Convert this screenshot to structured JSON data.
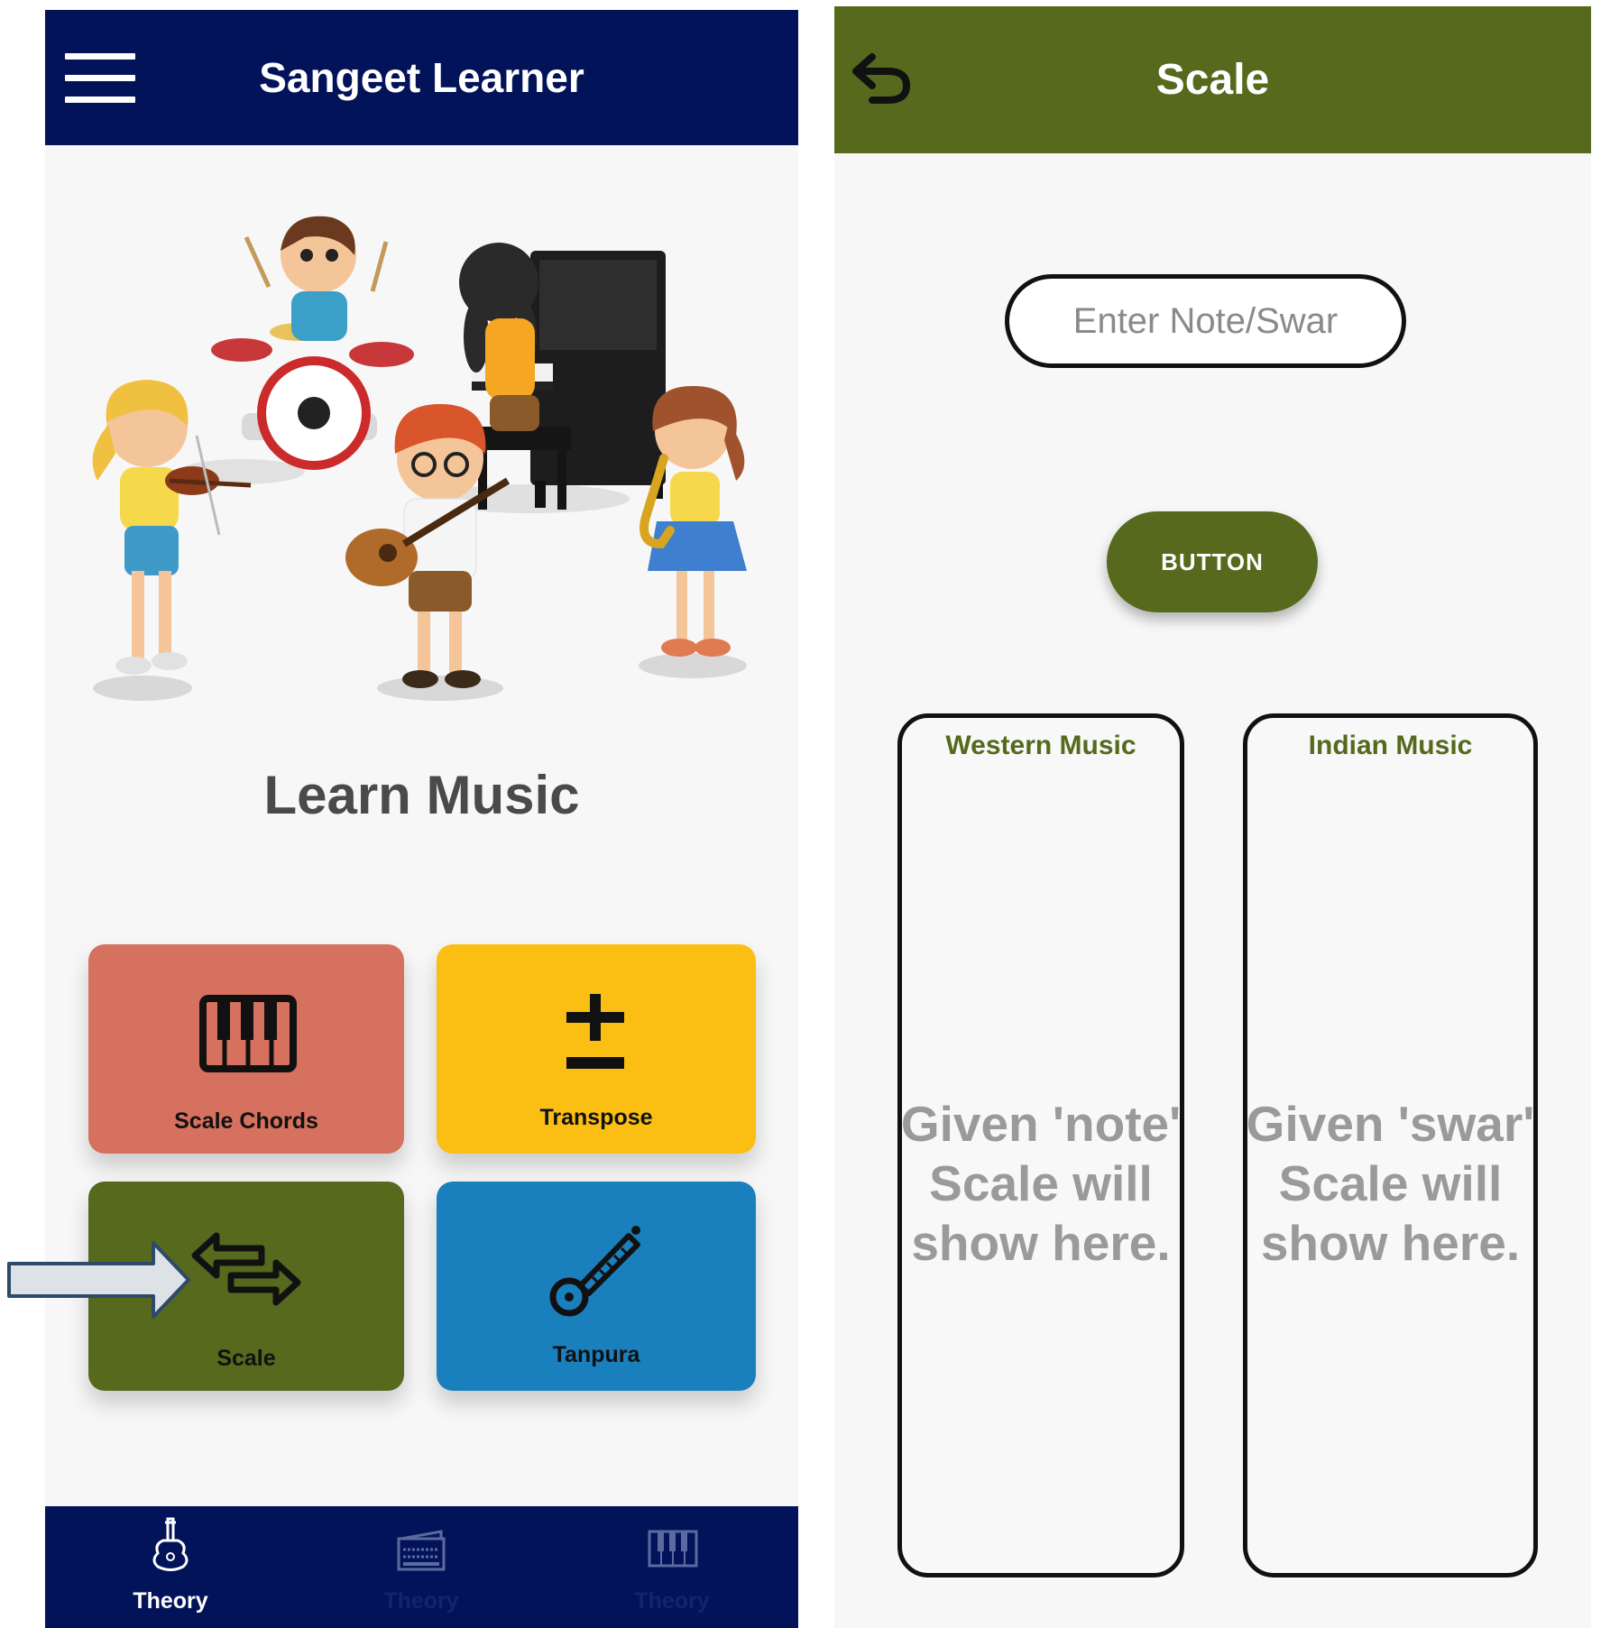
{
  "left_screen": {
    "app_bar": {
      "title": "Sangeet Learner",
      "menu_icon": "hamburger-menu-icon",
      "color": "#02135a"
    },
    "hero_image": "children playing drums, violin, guitar, piano and saxophone",
    "heading": "Learn Music",
    "tiles": [
      {
        "label": "Scale Chords",
        "icon": "piano-keys-icon",
        "color": "#d6705f"
      },
      {
        "label": "Transpose",
        "icon": "plus-minus-icon",
        "color": "#fbbe12"
      },
      {
        "label": "Scale",
        "icon": "swap-arrows-icon",
        "color": "#56691c"
      },
      {
        "label": "Tanpura",
        "icon": "tanpura-icon",
        "color": "#1a7fbd"
      }
    ],
    "bottom_nav": [
      {
        "label": "Theory",
        "icon": "guitar-icon",
        "active": true
      },
      {
        "label": "Theory",
        "icon": "harmonium-icon",
        "active": false
      },
      {
        "label": "Theory",
        "icon": "piano-icon",
        "active": false
      }
    ]
  },
  "right_screen": {
    "app_bar": {
      "title": "Scale",
      "back_icon": "back-arrow-icon",
      "color": "#56691c"
    },
    "input": {
      "placeholder": "Enter Note/Swar",
      "value": ""
    },
    "button_label": "BUTTON",
    "western": {
      "heading": "Western Music",
      "placeholder": "Given 'note'\nScale will\nshow here."
    },
    "indian": {
      "heading": "Indian Music",
      "placeholder": "Given 'swar'\nScale will\nshow here."
    }
  }
}
